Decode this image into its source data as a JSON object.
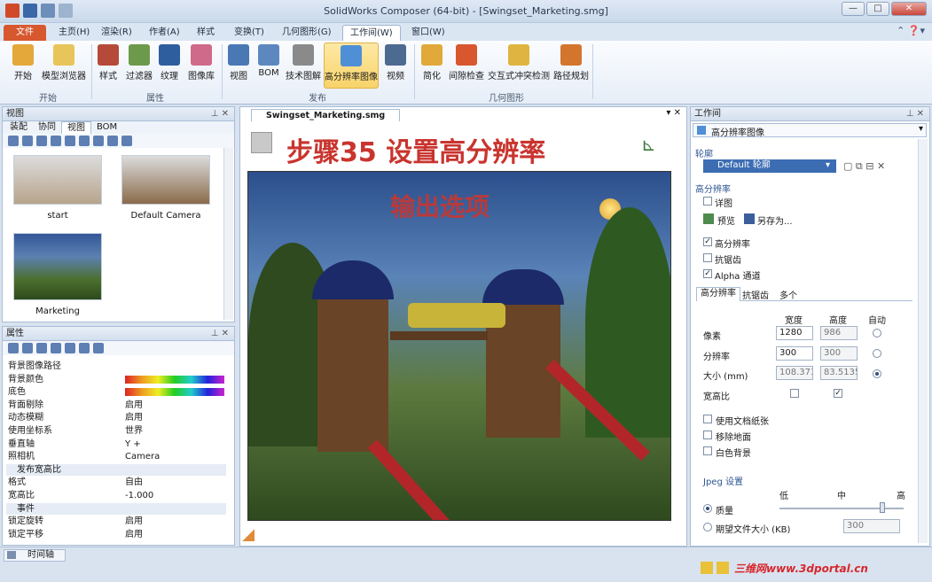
{
  "window": {
    "title": "SolidWorks Composer (64-bit) - [Swingset_Marketing.smg]"
  },
  "tabs": [
    {
      "label": "文件"
    },
    {
      "label": "主页(H)"
    },
    {
      "label": "渲染(R)"
    },
    {
      "label": "作者(A)"
    },
    {
      "label": "样式"
    },
    {
      "label": "变换(T)"
    },
    {
      "label": "几何图形(G)"
    },
    {
      "label": "工作间(W)"
    },
    {
      "label": "窗口(W)"
    }
  ],
  "ribbon": {
    "buttons": [
      {
        "label": "开始"
      },
      {
        "label": "模型浏览器"
      },
      {
        "label": "样式"
      },
      {
        "label": "过滤器"
      },
      {
        "label": "纹理"
      },
      {
        "label": "图像库"
      },
      {
        "label": "视图"
      },
      {
        "label": "BOM"
      },
      {
        "label": "技术图解"
      },
      {
        "label": "高分辨率图像"
      },
      {
        "label": "视频"
      },
      {
        "label": "简化"
      },
      {
        "label": "间隙检查"
      },
      {
        "label": "交互式冲突检测"
      },
      {
        "label": "路径规划"
      }
    ],
    "groups": [
      "开始",
      "属性",
      "发布",
      "几何图形"
    ]
  },
  "views_panel": {
    "title": "视图",
    "tabs": [
      "装配",
      "协同",
      "视图",
      "BOM"
    ],
    "thumbs": [
      "start",
      "Default Camera",
      "Marketing"
    ]
  },
  "props_panel": {
    "title": "属性",
    "rows": [
      {
        "k": "背景图像路径",
        "v": ""
      },
      {
        "k": "背景颜色",
        "v": ""
      },
      {
        "k": "底色",
        "v": ""
      },
      {
        "k": "背面剔除",
        "v": "启用"
      },
      {
        "k": "动态模糊",
        "v": "启用"
      },
      {
        "k": "使用坐标系",
        "v": "世界"
      },
      {
        "k": "垂直轴",
        "v": "Y +"
      },
      {
        "k": "照相机",
        "v": "Camera"
      },
      {
        "k": "发布宽高比",
        "v": ""
      },
      {
        "k": "格式",
        "v": "自由"
      },
      {
        "k": "宽高比",
        "v": "-1.000"
      },
      {
        "k": "事件",
        "v": ""
      },
      {
        "k": "锁定旋转",
        "v": "启用"
      },
      {
        "k": "锁定平移",
        "v": "启用"
      }
    ]
  },
  "document": {
    "tab": "Swingset_Marketing.smg",
    "heading": "步骤35  设置高分辨率",
    "subheading": "输出选项"
  },
  "workshop": {
    "title": "工作间",
    "dropdown": "高分辨率图像",
    "profile_label": "轮廓",
    "profile_value": "Default 轮廓",
    "section_hires": "高分辨率",
    "detail": "详图",
    "preview": "预览",
    "saveas": "另存为...",
    "check_hires": "高分辨率",
    "check_aa": "抗锯齿",
    "check_alpha": "Alpha 通道",
    "subtabs": [
      "高分辨率",
      "抗锯齿",
      "多个"
    ],
    "col_width": "宽度",
    "col_height": "高度",
    "col_auto": "自动",
    "row_pixels": "像素",
    "row_res": "分辨率",
    "row_size": "大小 (mm)",
    "row_aspect": "宽高比",
    "pix_w": "1280",
    "pix_h": "986",
    "res_w": "300",
    "res_h": "300",
    "size_w": "108.373",
    "size_h": "83.5135",
    "use_paper": "使用文档纸张",
    "remove_ground": "移除地面",
    "white_bg": "白色背景",
    "jpeg": "Jpeg 设置",
    "low": "低",
    "mid": "中",
    "high": "高",
    "quality": "质量",
    "expect_size": "期望文件大小 (KB)",
    "expect_val": "300"
  },
  "status": {
    "timeline": "时间轴",
    "watermark": "三维网www.3dportal.cn"
  }
}
